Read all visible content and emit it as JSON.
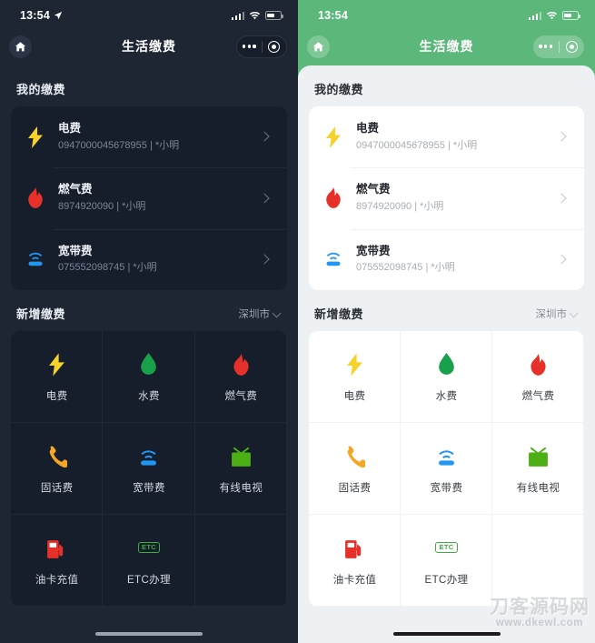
{
  "panels": [
    {
      "theme": "dark",
      "status_bar": {
        "time": "13:54",
        "location_arrow": true,
        "signal_icon": "signal-bars-icon",
        "wifi_icon": "wifi-icon",
        "battery_icon": "battery-icon"
      },
      "nav": {
        "home_icon": "home-icon",
        "title": "生活缴费",
        "more_icon": "more-dots-icon",
        "target_icon": "target-circle-icon"
      }
    },
    {
      "theme": "light",
      "status_bar": {
        "time": "13:54",
        "location_arrow": false,
        "signal_icon": "signal-bars-icon",
        "wifi_icon": "wifi-icon",
        "battery_icon": "battery-icon"
      },
      "nav": {
        "home_icon": "home-icon",
        "title": "生活缴费",
        "more_icon": "more-dots-icon",
        "target_icon": "target-circle-icon"
      }
    }
  ],
  "my_payments": {
    "title": "我的缴费",
    "items": [
      {
        "name": "电费",
        "account": "0947000045678955 | *小明",
        "icon": "lightning-bolt-icon",
        "color": "#f5d32b"
      },
      {
        "name": "燃气费",
        "account": "8974920090 | *小明",
        "icon": "flame-icon",
        "color": "#e6302a"
      },
      {
        "name": "宽带费",
        "account": "075552098745 | *小明",
        "icon": "router-wifi-icon",
        "color": "#2196f3"
      }
    ],
    "chevron_icon": "chevron-right-icon"
  },
  "add_payment": {
    "title": "新增缴费",
    "city": "深圳市",
    "city_chevron_icon": "chevron-down-icon",
    "items": [
      {
        "label": "电费",
        "icon": "lightning-bolt-icon",
        "color": "#f5d32b"
      },
      {
        "label": "水费",
        "icon": "water-drop-icon",
        "color": "#18a04a"
      },
      {
        "label": "燃气费",
        "icon": "flame-icon",
        "color": "#e6302a"
      },
      {
        "label": "固话费",
        "icon": "phone-handset-icon",
        "color": "#f5a623"
      },
      {
        "label": "宽带费",
        "icon": "router-wifi-icon",
        "color": "#2196f3"
      },
      {
        "label": "有线电视",
        "icon": "television-icon",
        "color": "#4caf16"
      },
      {
        "label": "油卡充值",
        "icon": "fuel-pump-icon",
        "color": "#e6302a"
      },
      {
        "label": "ETC办理",
        "icon": "etc-badge-icon",
        "color": "#3fae3f",
        "badge_text": "ETC"
      }
    ]
  },
  "watermark": {
    "cn": "刀客源码网",
    "en": "www.dkewl.com"
  },
  "colors": {
    "dark_bg": "#1e2634",
    "dark_card": "#161d2b",
    "light_header": "#5cb87a",
    "light_bg": "#eef1f3",
    "light_card": "#ffffff"
  }
}
